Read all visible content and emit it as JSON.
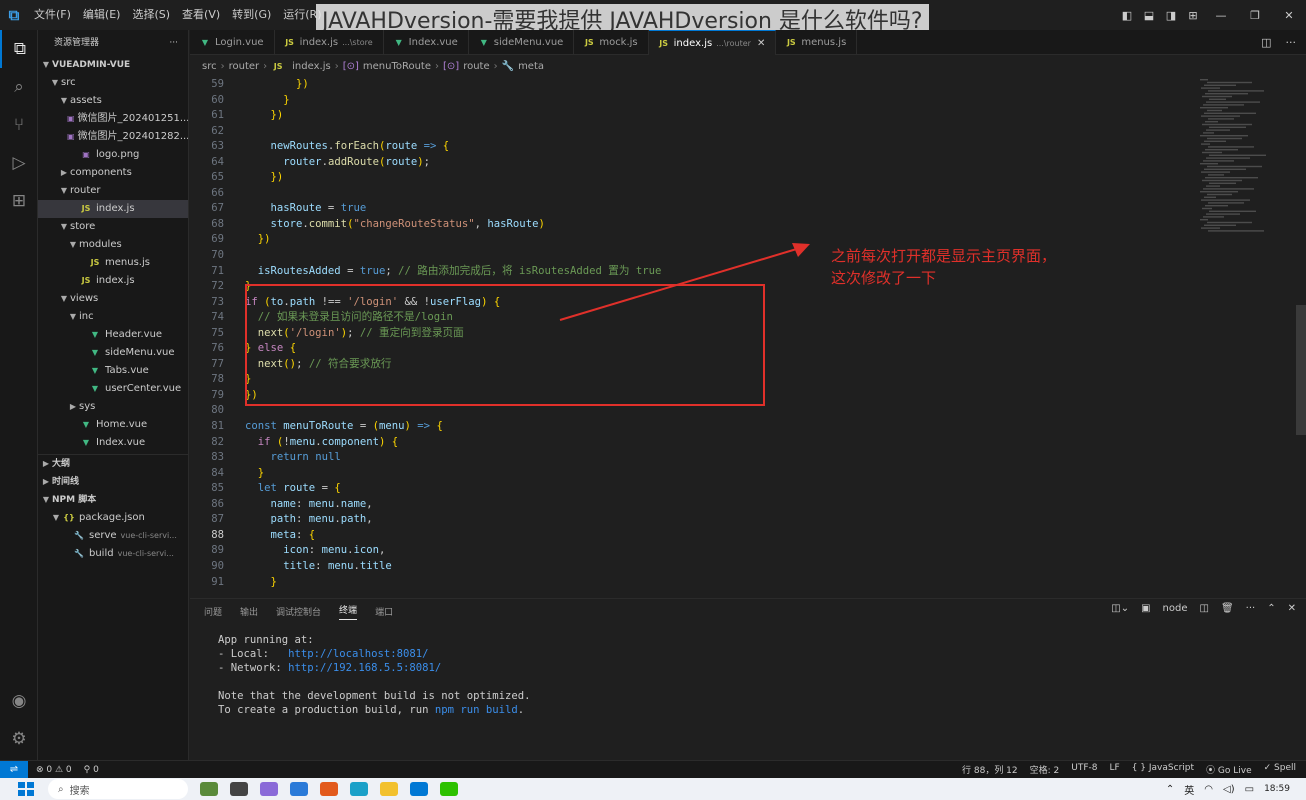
{
  "title_overlay": "JAVAHDversion-需要我提供 JAVAHDversion 是什么软件吗?",
  "menu": [
    "文件(F)",
    "编辑(E)",
    "选择(S)",
    "查看(V)",
    "转到(G)",
    "运行(R)"
  ],
  "explorer": {
    "title": "资源管理器",
    "more": "···",
    "root": "VUEADMIN-VUE",
    "items": [
      {
        "label": "src",
        "type": "folder-open",
        "indent": 1
      },
      {
        "label": "assets",
        "type": "folder-open",
        "indent": 2
      },
      {
        "label": "微信图片_202401251...",
        "type": "img",
        "indent": 3
      },
      {
        "label": "微信图片_202401282...",
        "type": "img",
        "indent": 3
      },
      {
        "label": "logo.png",
        "type": "img",
        "indent": 3
      },
      {
        "label": "components",
        "type": "folder",
        "indent": 2
      },
      {
        "label": "router",
        "type": "folder-open",
        "indent": 2
      },
      {
        "label": "index.js",
        "type": "js",
        "indent": 3,
        "selected": true
      },
      {
        "label": "store",
        "type": "folder-open",
        "indent": 2
      },
      {
        "label": "modules",
        "type": "folder-open",
        "indent": 3
      },
      {
        "label": "menus.js",
        "type": "js",
        "indent": 4
      },
      {
        "label": "index.js",
        "type": "js",
        "indent": 3
      },
      {
        "label": "views",
        "type": "folder-open",
        "indent": 2
      },
      {
        "label": "inc",
        "type": "folder-open",
        "indent": 3
      },
      {
        "label": "Header.vue",
        "type": "vue",
        "indent": 4
      },
      {
        "label": "sideMenu.vue",
        "type": "vue",
        "indent": 4
      },
      {
        "label": "Tabs.vue",
        "type": "vue",
        "indent": 4
      },
      {
        "label": "userCenter.vue",
        "type": "vue",
        "indent": 4
      },
      {
        "label": "sys",
        "type": "folder",
        "indent": 3
      },
      {
        "label": "Home.vue",
        "type": "vue",
        "indent": 3
      },
      {
        "label": "Index.vue",
        "type": "vue",
        "indent": 3
      }
    ],
    "sections": [
      "大纲",
      "时间线"
    ],
    "npm": {
      "title": "NPM 脚本",
      "file": "package.json",
      "scripts": [
        {
          "name": "serve",
          "cmd": "vue-cli-servi..."
        },
        {
          "name": "build",
          "cmd": "vue-cli-servi..."
        }
      ]
    }
  },
  "tabs": [
    {
      "label": "Login.vue",
      "type": "vue"
    },
    {
      "label": "index.js",
      "hint": "...\\store",
      "type": "js"
    },
    {
      "label": "Index.vue",
      "type": "vue"
    },
    {
      "label": "sideMenu.vue",
      "type": "vue"
    },
    {
      "label": "mock.js",
      "type": "js"
    },
    {
      "label": "index.js",
      "hint": "...\\router",
      "type": "js",
      "active": true
    },
    {
      "label": "menus.js",
      "type": "js"
    }
  ],
  "breadcrumb": [
    "src",
    "router",
    "index.js",
    "menuToRoute",
    "route",
    "meta"
  ],
  "code_lines": [
    {
      "n": 59,
      "html": "        })"
    },
    {
      "n": 60,
      "html": "      }"
    },
    {
      "n": 61,
      "html": "    })"
    },
    {
      "n": 62,
      "html": ""
    },
    {
      "n": 63,
      "html": "    newRoutes.forEach(route => {"
    },
    {
      "n": 64,
      "html": "      router.addRoute(route);"
    },
    {
      "n": 65,
      "html": "    })"
    },
    {
      "n": 66,
      "html": ""
    },
    {
      "n": 67,
      "html": "    hasRoute = true"
    },
    {
      "n": 68,
      "html": "    store.commit(\"changeRouteStatus\", hasRoute)"
    },
    {
      "n": 69,
      "html": "  })"
    },
    {
      "n": 70,
      "html": ""
    },
    {
      "n": 71,
      "html": "  isRoutesAdded = true; // 路由添加完成后，将 isRoutesAdded 置为 true"
    },
    {
      "n": 72,
      "html": "}"
    },
    {
      "n": 73,
      "html": "if (to.path !== '/login' && !userFlag) {"
    },
    {
      "n": 74,
      "html": "  // 如果未登录且访问的路径不是/login"
    },
    {
      "n": 75,
      "html": "  next('/login'); // 重定向到登录页面"
    },
    {
      "n": 76,
      "html": "} else {"
    },
    {
      "n": 77,
      "html": "  next(); // 符合要求放行"
    },
    {
      "n": 78,
      "html": "}"
    },
    {
      "n": 79,
      "html": "})"
    },
    {
      "n": 80,
      "html": ""
    },
    {
      "n": 81,
      "html": "const menuToRoute = (menu) => {"
    },
    {
      "n": 82,
      "html": "  if (!menu.component) {"
    },
    {
      "n": 83,
      "html": "    return null"
    },
    {
      "n": 84,
      "html": "  }"
    },
    {
      "n": 85,
      "html": "  let route = {"
    },
    {
      "n": 86,
      "html": "    name: menu.name,"
    },
    {
      "n": 87,
      "html": "    path: menu.path,"
    },
    {
      "n": 88,
      "html": "    meta: {"
    },
    {
      "n": 89,
      "html": "      icon: menu.icon,"
    },
    {
      "n": 90,
      "html": "      title: menu.title"
    },
    {
      "n": 91,
      "html": "    }"
    }
  ],
  "annotation": "之前每次打开都是显示主页界面，\n这次修改了一下",
  "panel": {
    "tabs": [
      "问题",
      "输出",
      "调试控制台",
      "终端",
      "端口"
    ],
    "active_tab": "终端",
    "terminal_label": "node",
    "lines": [
      {
        "pre": "App running at:"
      },
      {
        "pre": "- Local:   ",
        "url": "http://localhost:8081/"
      },
      {
        "pre": "- Network: ",
        "url": "http://192.168.5.5:8081/"
      },
      {
        "pre": ""
      },
      {
        "pre": "Note that the development build is not optimized."
      },
      {
        "pre": "To create a production build, run ",
        "url": "npm run build",
        "post": "."
      }
    ]
  },
  "status": {
    "errors": "⊗ 0 ⚠ 0",
    "ports": "⚲ 0",
    "position": "行 88，列 12",
    "spaces": "空格: 2",
    "encoding": "UTF-8",
    "eol": "LF",
    "language": "{ } JavaScript",
    "golive": "Go Live",
    "spell": "✓ Spell"
  },
  "taskbar": {
    "search_placeholder": "搜索",
    "ime": "英",
    "time": "18:59"
  }
}
